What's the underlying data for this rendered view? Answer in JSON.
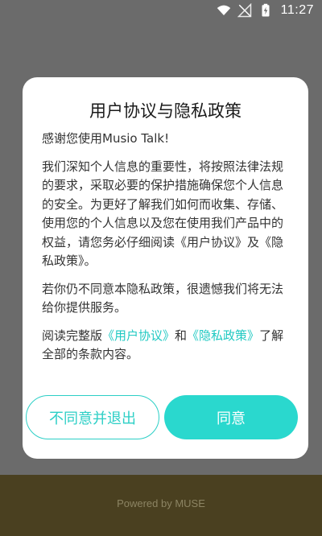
{
  "status_bar": {
    "time": "11:27",
    "icons": [
      "wifi-icon",
      "no-signal-icon",
      "battery-charging-icon"
    ]
  },
  "dialog": {
    "title": "用户协议与隐私政策",
    "greeting": "感谢您使用Musio Talk!",
    "paragraph1": "我们深知个人信息的重要性，将按照法律法规的要求，采取必要的保护措施确保您个人信息的安全。为更好了解我们如何而收集、存储、使用您的个人信息以及您在使用我们产品中的权益，请您务必仔细阅读《用户协议》及《隐私政策》。",
    "paragraph2": "若你仍不同意本隐私政策，很遗憾我们将无法给你提供服务。",
    "paragraph3": {
      "prefix": "阅读完整版",
      "link_user_agreement": "《用户协议》",
      "middle": "和",
      "link_privacy_policy": "《隐私政策》",
      "suffix": "了解全部的条款内容。"
    },
    "decline_label": "不同意并退出",
    "agree_label": "同意"
  },
  "footer": {
    "powered_by": "Powered by MUSE"
  },
  "colors": {
    "accent": "#2ad8ce",
    "backdrop": "#6b6b6b",
    "bottom_band": "#4a4020"
  }
}
